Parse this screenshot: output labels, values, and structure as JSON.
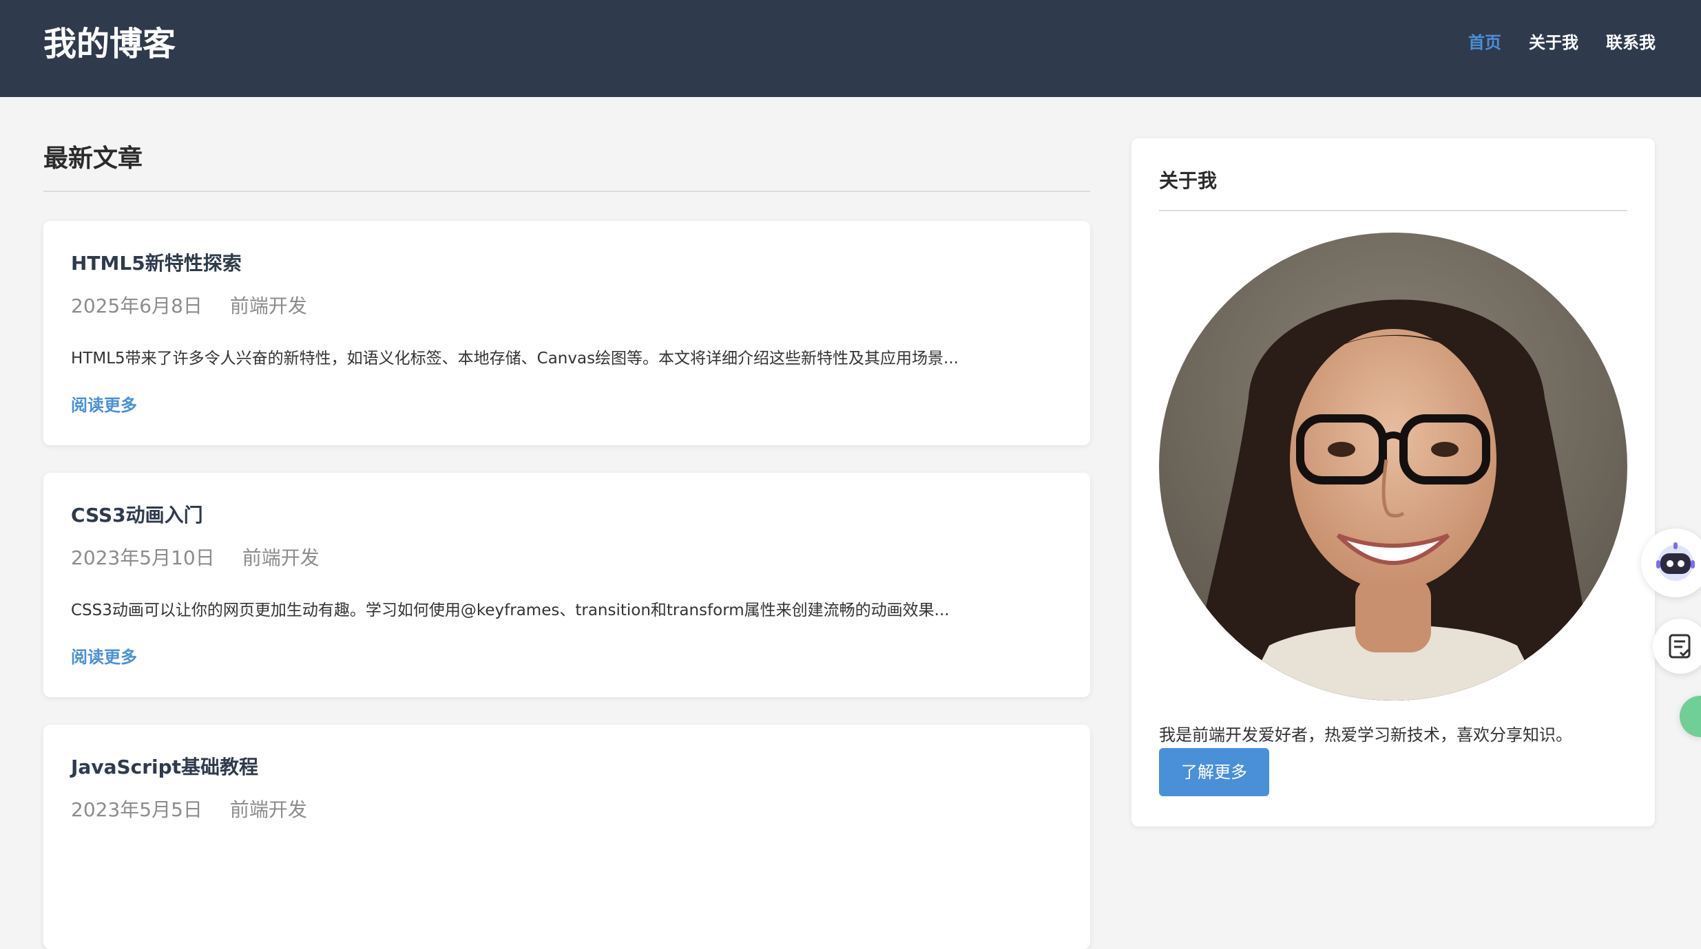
{
  "header": {
    "site_title": "我的博客",
    "nav": [
      "首页",
      "关于我",
      "联系我"
    ]
  },
  "main": {
    "section_title": "最新文章",
    "posts": [
      {
        "title": "HTML5新特性探索",
        "date": "2025年6月8日",
        "category": "前端开发",
        "excerpt": "HTML5带来了许多令人兴奋的新特性，如语义化标签、本地存储、Canvas绘图等。本文将详细介绍这些新特性及其应用场景...",
        "read_more": "阅读更多"
      },
      {
        "title": "CSS3动画入门",
        "date": "2023年5月10日",
        "category": "前端开发",
        "excerpt": "CSS3动画可以让你的网页更加生动有趣。学习如何使用@keyframes、transition和transform属性来创建流畅的动画效果...",
        "read_more": "阅读更多"
      },
      {
        "title": "JavaScript基础教程",
        "date": "2023年5月5日",
        "category": "前端开发"
      }
    ]
  },
  "sidebar": {
    "title": "关于我",
    "bio": "我是前端开发爱好者，热爱学习新技术，喜欢分享知识。",
    "button": "了解更多"
  },
  "colors": {
    "header_bg": "#2f3a4c",
    "accent": "#4a90d9",
    "page_bg": "#f4f4f4"
  },
  "icons": [
    "robot-assistant-icon",
    "notes-checklist-icon"
  ]
}
